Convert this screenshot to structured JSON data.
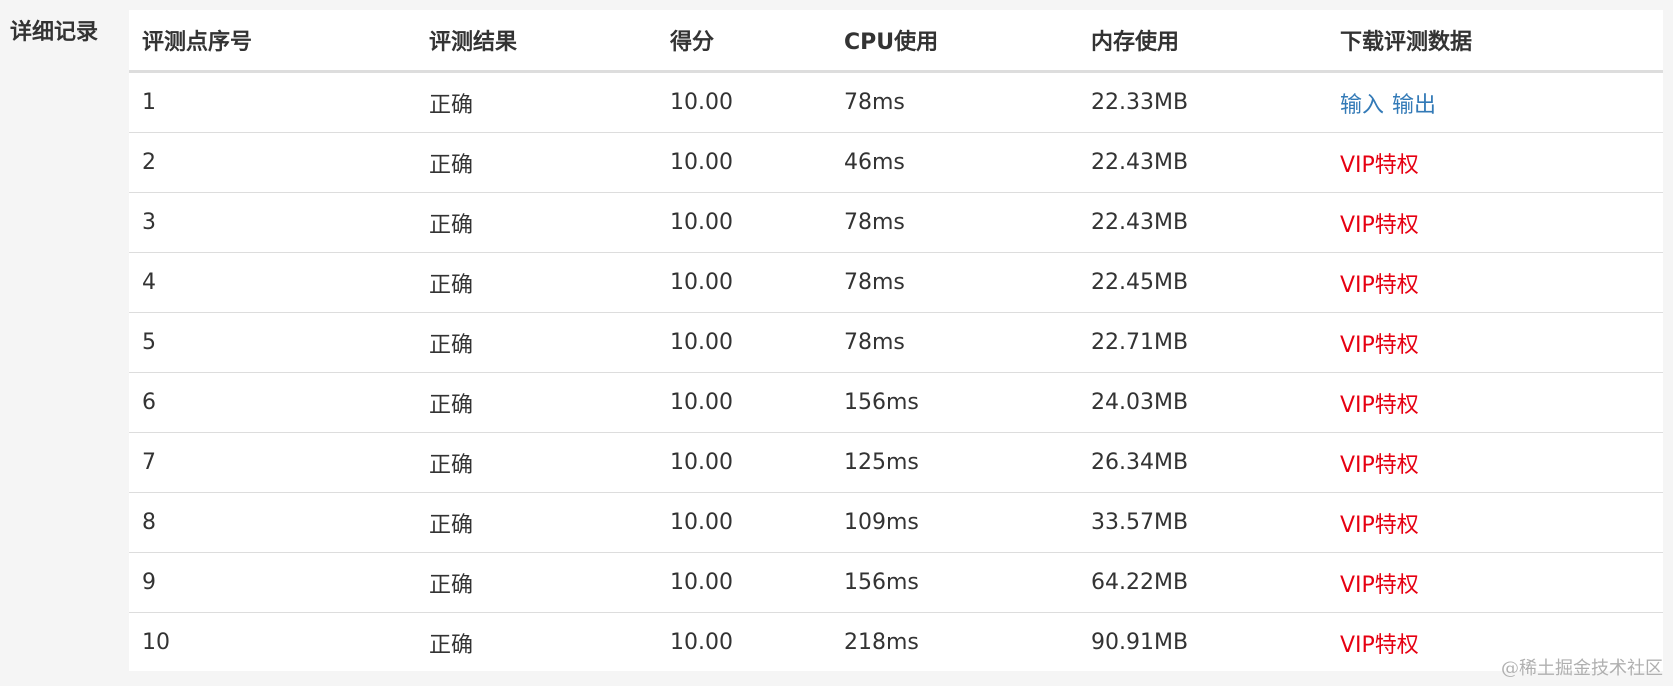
{
  "section": {
    "label": "详细记录"
  },
  "table": {
    "headers": [
      "评测点序号",
      "评测结果",
      "得分",
      "CPU使用",
      "内存使用",
      "下载评测数据"
    ],
    "rows": [
      {
        "index": "1",
        "result": "正确",
        "score": "10.00",
        "cpu": "78ms",
        "memory": "22.33MB",
        "download": {
          "type": "links",
          "input": "输入",
          "output": "输出"
        }
      },
      {
        "index": "2",
        "result": "正确",
        "score": "10.00",
        "cpu": "46ms",
        "memory": "22.43MB",
        "download": {
          "type": "vip",
          "text": "VIP特权"
        }
      },
      {
        "index": "3",
        "result": "正确",
        "score": "10.00",
        "cpu": "78ms",
        "memory": "22.43MB",
        "download": {
          "type": "vip",
          "text": "VIP特权"
        }
      },
      {
        "index": "4",
        "result": "正确",
        "score": "10.00",
        "cpu": "78ms",
        "memory": "22.45MB",
        "download": {
          "type": "vip",
          "text": "VIP特权"
        }
      },
      {
        "index": "5",
        "result": "正确",
        "score": "10.00",
        "cpu": "78ms",
        "memory": "22.71MB",
        "download": {
          "type": "vip",
          "text": "VIP特权"
        }
      },
      {
        "index": "6",
        "result": "正确",
        "score": "10.00",
        "cpu": "156ms",
        "memory": "24.03MB",
        "download": {
          "type": "vip",
          "text": "VIP特权"
        }
      },
      {
        "index": "7",
        "result": "正确",
        "score": "10.00",
        "cpu": "125ms",
        "memory": "26.34MB",
        "download": {
          "type": "vip",
          "text": "VIP特权"
        }
      },
      {
        "index": "8",
        "result": "正确",
        "score": "10.00",
        "cpu": "109ms",
        "memory": "33.57MB",
        "download": {
          "type": "vip",
          "text": "VIP特权"
        }
      },
      {
        "index": "9",
        "result": "正确",
        "score": "10.00",
        "cpu": "156ms",
        "memory": "64.22MB",
        "download": {
          "type": "vip",
          "text": "VIP特权"
        }
      },
      {
        "index": "10",
        "result": "正确",
        "score": "10.00",
        "cpu": "218ms",
        "memory": "90.91MB",
        "download": {
          "type": "vip",
          "text": "VIP特权"
        }
      }
    ]
  },
  "watermark": {
    "text": "@稀土掘金技术社区"
  },
  "colors": {
    "link": "#337ab7",
    "vip": "#e60012",
    "text": "#333333",
    "background": "#f5f5f5"
  }
}
